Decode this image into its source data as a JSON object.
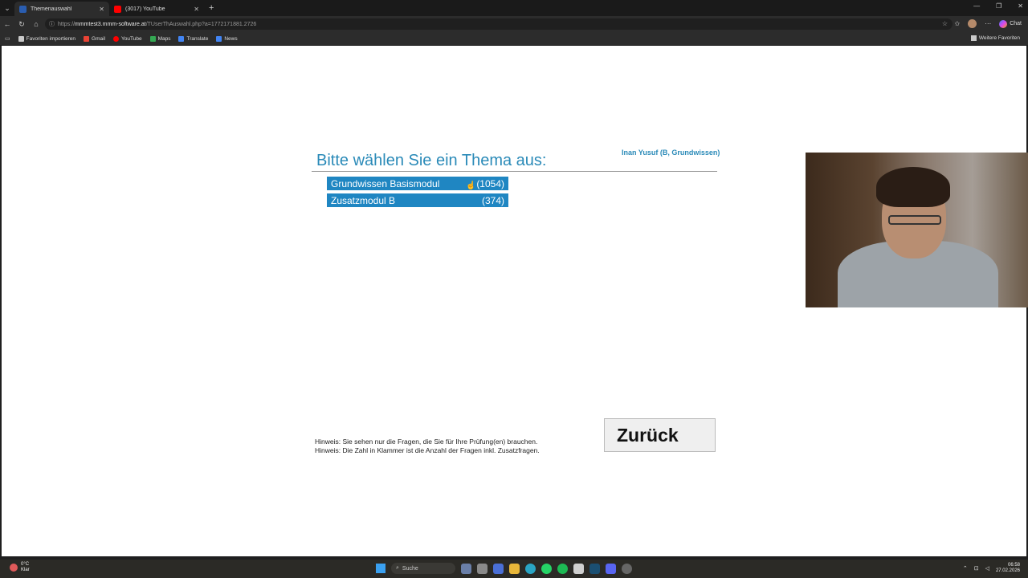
{
  "browser": {
    "tabs": [
      {
        "title": "Themenauswahl",
        "active": true,
        "favicon_color": "#2a5db0"
      },
      {
        "title": "(3017) YouTube",
        "active": false,
        "favicon_color": "#ff0000"
      }
    ],
    "url_prefix": "https://",
    "url_host": "mmmtest3.mmm-software.at",
    "url_path": "/TUserThAuswahl.php?a=1772171881.2726",
    "chat_label": "Chat",
    "bookmarks": [
      {
        "label": "Favoriten importieren",
        "icon": "folder-icon",
        "color": "#c9c9c9"
      },
      {
        "label": "Gmail",
        "icon": "gmail-icon",
        "color": "#ea4335"
      },
      {
        "label": "YouTube",
        "icon": "youtube-icon",
        "color": "#ff0000"
      },
      {
        "label": "Maps",
        "icon": "maps-icon",
        "color": "#34a853"
      },
      {
        "label": "Translate",
        "icon": "translate-icon",
        "color": "#4285f4"
      },
      {
        "label": "News",
        "icon": "news-icon",
        "color": "#4285f4"
      }
    ],
    "other_favorites": "Weitere Favoriten"
  },
  "page": {
    "user_info": "Inan Yusuf (B, Grundwissen)",
    "heading": "Bitte wählen Sie ein Thema aus:",
    "topics": [
      {
        "name": "Grundwissen Basismodul",
        "count": "(1054)"
      },
      {
        "name": "Zusatzmodul B",
        "count": "(374)"
      }
    ],
    "hints": [
      "Hinweis: Sie sehen nur die Fragen, die Sie für Ihre Prüfung(en) brauchen.",
      "Hinweis: Die Zahl in Klammer ist die Anzahl der Fragen inkl. Zusatzfragen."
    ],
    "back_button": "Zurück",
    "accent_color": "#1f86c2"
  },
  "taskbar": {
    "weather_temp": "0°C",
    "weather_desc": "Klar",
    "search_label": "Suche",
    "time": "06:58",
    "date": "27.02.2026"
  }
}
